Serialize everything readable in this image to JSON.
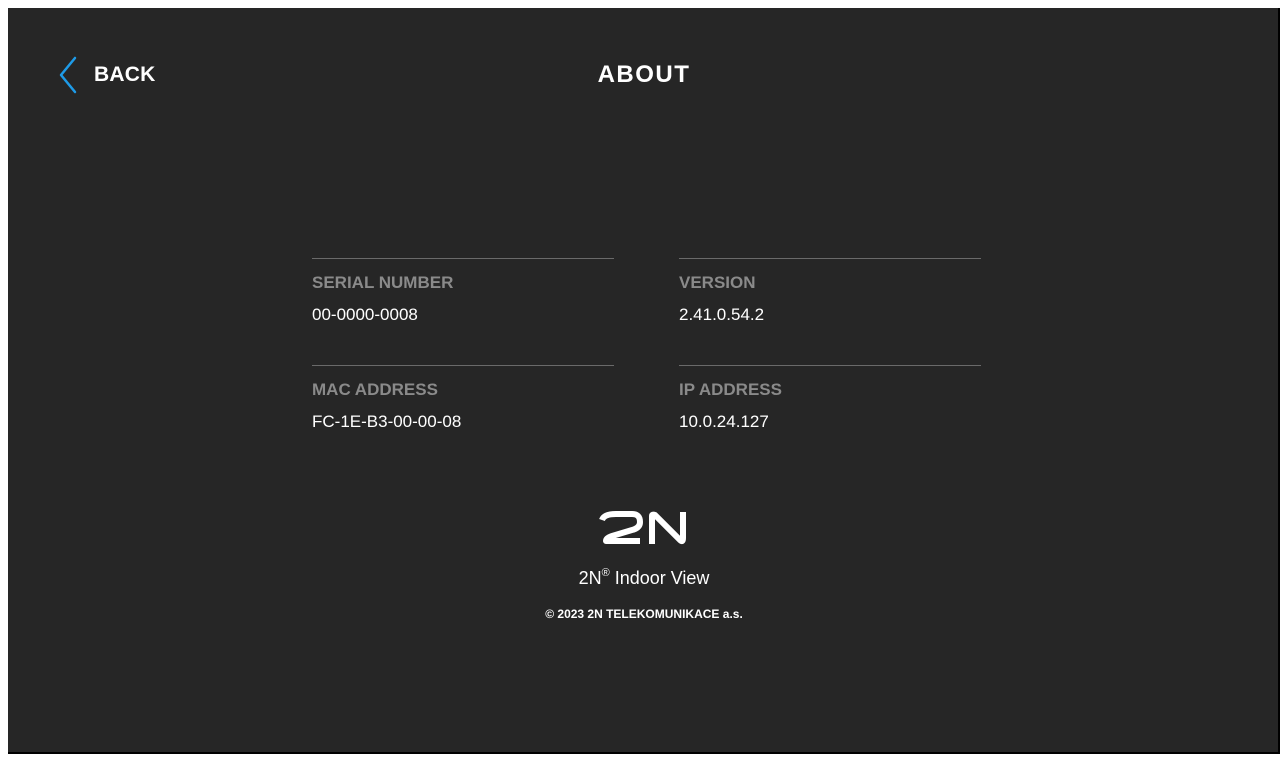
{
  "header": {
    "back_label": "BACK",
    "back_icon": "chevron-left-icon",
    "title": "ABOUT",
    "accent_color": "#1e9be8"
  },
  "info": {
    "serial_number": {
      "label": "SERIAL NUMBER",
      "value": "00-0000-0008"
    },
    "version": {
      "label": "VERSION",
      "value": "2.41.0.54.2"
    },
    "mac_address": {
      "label": "MAC ADDRESS",
      "value": "FC-1E-B3-00-00-08"
    },
    "ip_address": {
      "label": "IP ADDRESS",
      "value": "10.0.24.127"
    }
  },
  "footer": {
    "logo_text": "2N",
    "product_name": "2N",
    "product_reg_mark": "®",
    "product_suffix": " Indoor View",
    "copyright": "© 2023 2N TELEKOMUNIKACE a.s."
  }
}
